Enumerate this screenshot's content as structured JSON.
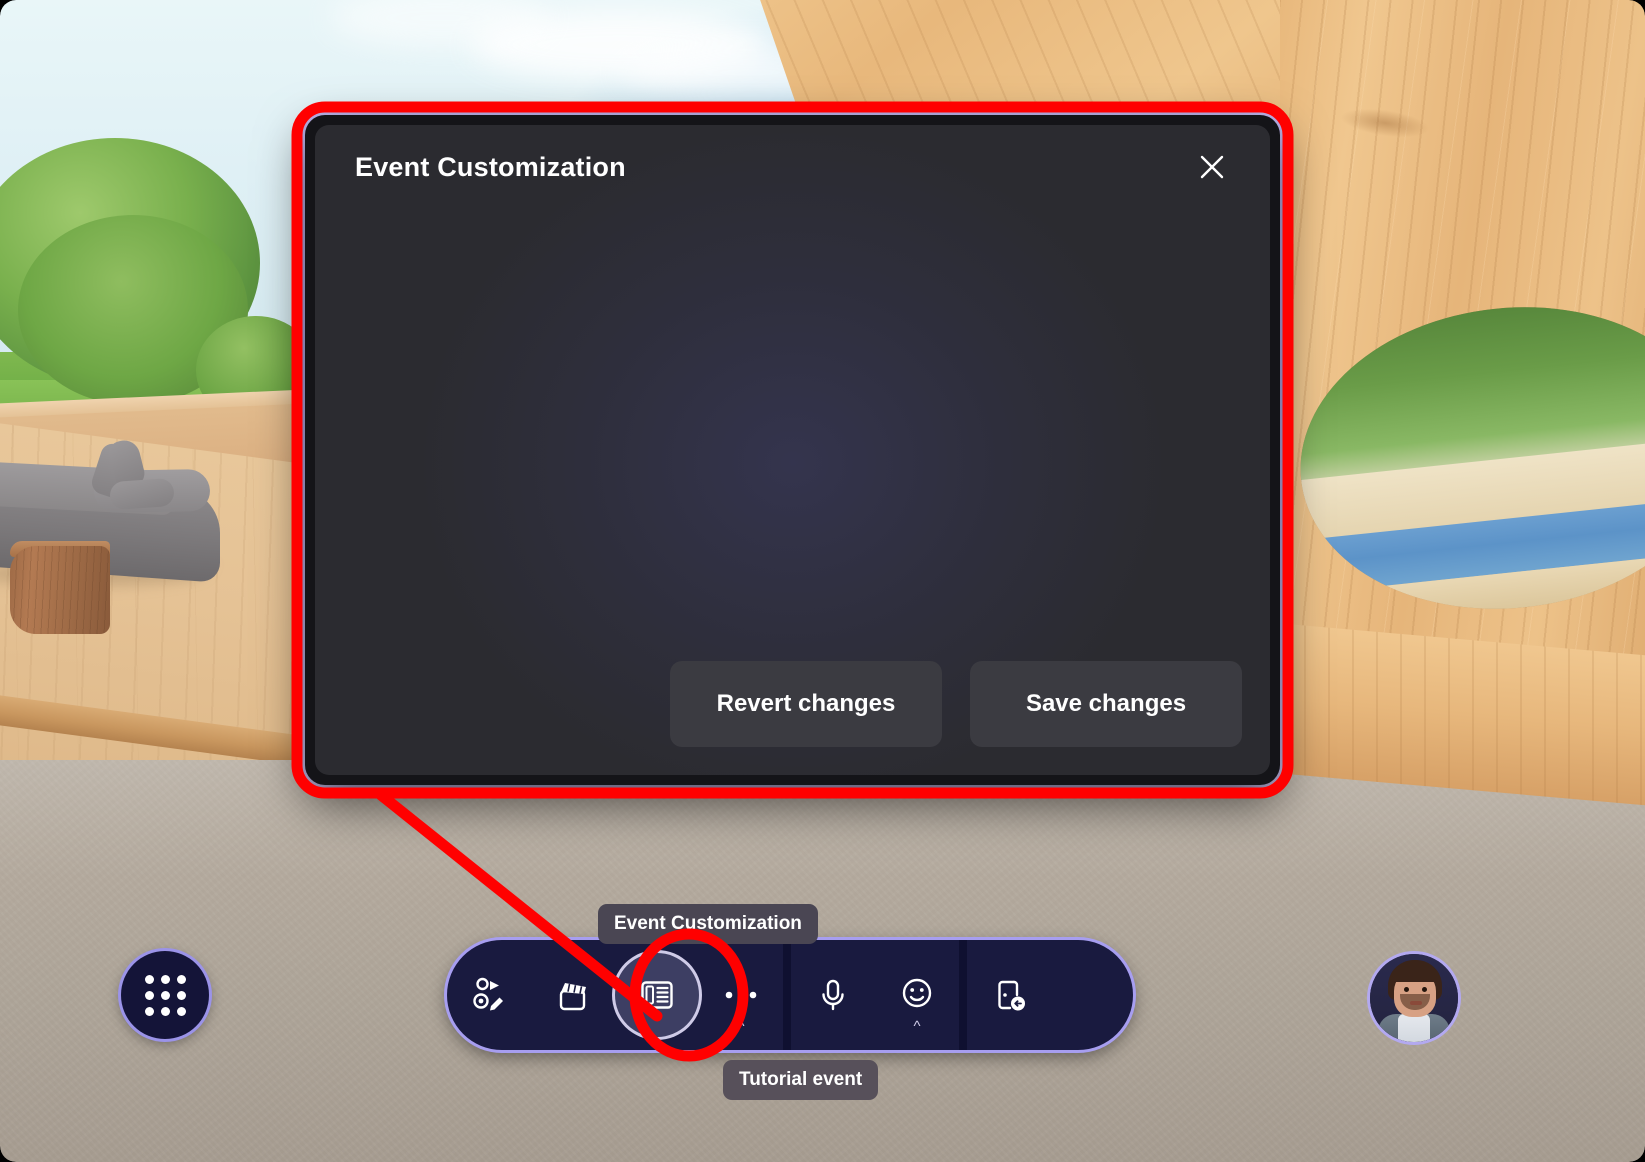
{
  "dialog": {
    "title": "Event Customization",
    "close_icon": "close-icon",
    "body_state": "",
    "buttons": {
      "revert_label": "Revert changes",
      "save_label": "Save changes"
    }
  },
  "tooltips": {
    "event_customization": "Event Customization",
    "tutorial_event": "Tutorial event"
  },
  "toolbar": {
    "apps_button": {
      "name": "apps-grid-button",
      "icon": "grid-dots-icon"
    },
    "items": [
      {
        "name": "avatar-customize-button",
        "icon": "avatar-pencil-icon",
        "label": "Avatar",
        "active": false,
        "has_caret": false
      },
      {
        "name": "effects-button",
        "icon": "clapperboard-icon",
        "label": "Effects",
        "active": false,
        "has_caret": false
      },
      {
        "name": "event-customization-button",
        "icon": "event-panel-icon",
        "label": "Event Customization",
        "active": true,
        "has_caret": false
      },
      {
        "name": "more-options-button",
        "icon": "ellipsis-icon",
        "label": "More",
        "active": false,
        "has_caret": true
      },
      {
        "name": "microphone-button",
        "icon": "microphone-icon",
        "label": "Microphone",
        "active": false,
        "has_caret": false
      },
      {
        "name": "reactions-button",
        "icon": "smiley-icon",
        "label": "Reactions",
        "active": false,
        "has_caret": true
      },
      {
        "name": "leave-button",
        "icon": "leave-door-icon",
        "label": "Leave",
        "active": false,
        "has_caret": false
      }
    ],
    "avatar": {
      "name": "user-avatar",
      "label": "User avatar"
    }
  },
  "annotation": {
    "highlight_color": "#FF0000",
    "shapes": [
      "dialog-outline-rect",
      "pointer-line",
      "toolbar-button-ellipse"
    ]
  },
  "colors": {
    "accent_border": "#A79EF0",
    "toolbar_bg": "#191A3F",
    "dialog_bg": "#2B2B30",
    "dialog_frame": "#141418",
    "button_bg": "#3B3B41",
    "tooltip_bg": "#4A4653",
    "highlight": "#FF0000"
  },
  "scene": {
    "description": "Virtual 3D venue",
    "elements": [
      "sky",
      "tree",
      "grass",
      "wooden-deck",
      "sofa",
      "side-table",
      "wooden-wall",
      "oval-window",
      "water",
      "concrete-floor"
    ]
  }
}
